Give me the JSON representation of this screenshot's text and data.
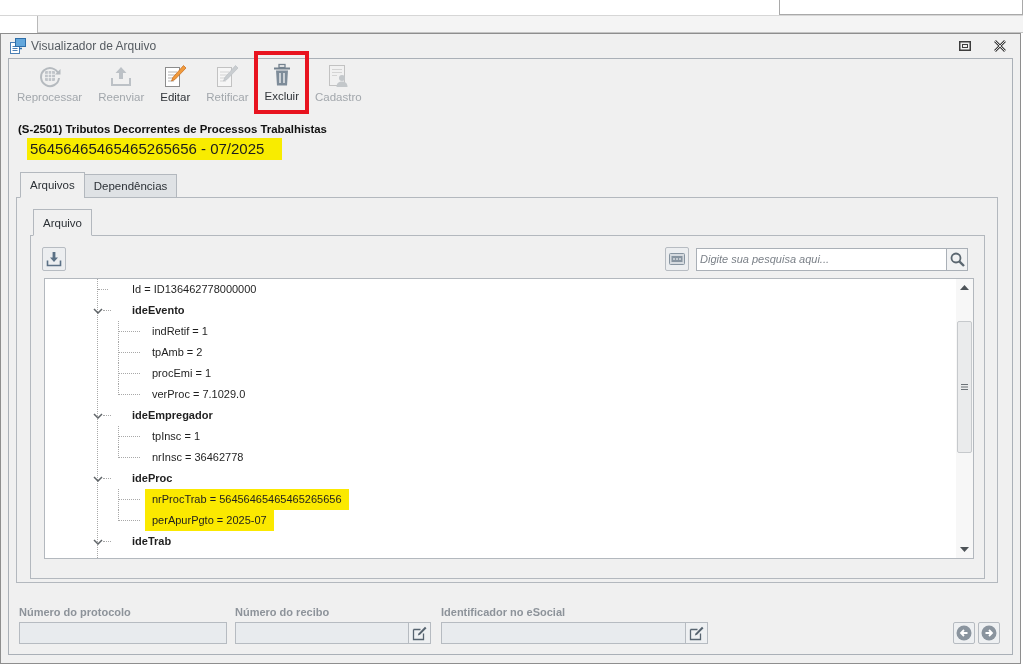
{
  "window": {
    "title": "Visualizador de Arquivo"
  },
  "toolbar": [
    {
      "kind": "reprocess",
      "label": "Reprocessar",
      "disabled": true,
      "marked": false
    },
    {
      "kind": "resend",
      "label": "Reenviar",
      "disabled": true,
      "marked": false
    },
    {
      "kind": "edit",
      "label": "Editar",
      "disabled": false,
      "marked": false
    },
    {
      "kind": "rectify",
      "label": "Retificar",
      "disabled": true,
      "marked": false
    },
    {
      "kind": "delete",
      "label": "Excluir",
      "disabled": false,
      "marked": true
    },
    {
      "kind": "register",
      "label": "Cadastro",
      "disabled": true,
      "marked": false
    }
  ],
  "record": {
    "title": "(S-2501) Tributos Decorrentes de Processos Trabalhistas",
    "subtitle": "56456465465465265656 - 07/2025",
    "highlighted": true
  },
  "tabs": [
    {
      "label": "Arquivos",
      "selected": true
    },
    {
      "label": "Dependências",
      "selected": false
    }
  ],
  "file_tabs": [
    {
      "label": "Arquivo",
      "selected": true
    }
  ],
  "search": {
    "placeholder": "Digite sua pesquisa aqui..."
  },
  "tree": [
    {
      "kind": "leaf",
      "label": "Id = ID136462778000000",
      "highlighted": false
    },
    {
      "kind": "group",
      "label": "ideEvento",
      "expanded": true,
      "highlighted": false,
      "children": [
        {
          "kind": "leaf",
          "label": "indRetif = 1",
          "highlighted": false
        },
        {
          "kind": "leaf",
          "label": "tpAmb = 2",
          "highlighted": false
        },
        {
          "kind": "leaf",
          "label": "procEmi = 1",
          "highlighted": false
        },
        {
          "kind": "leaf",
          "label": "verProc = 7.1029.0",
          "highlighted": false
        }
      ]
    },
    {
      "kind": "group",
      "label": "ideEmpregador",
      "expanded": true,
      "highlighted": false,
      "children": [
        {
          "kind": "leaf",
          "label": "tpInsc = 1",
          "highlighted": false
        },
        {
          "kind": "leaf",
          "label": "nrInsc = 36462778",
          "highlighted": false
        }
      ]
    },
    {
      "kind": "group",
      "label": "ideProc",
      "expanded": true,
      "highlighted": false,
      "children": [
        {
          "kind": "leaf",
          "label": "nrProcTrab = 56456465465465265656",
          "highlighted": true
        },
        {
          "kind": "leaf",
          "label": "perApurPgto = 2025-07",
          "highlighted": true
        }
      ]
    },
    {
      "kind": "group",
      "label": "ideTrab",
      "expanded": true,
      "highlighted": false
    }
  ],
  "fields": [
    {
      "label": "Número do protocolo",
      "kind": "plain",
      "disabled": true
    },
    {
      "label": "Número do recibo",
      "kind": "with_edit",
      "disabled": true
    },
    {
      "label": "Identificador no eSocial",
      "kind": "with_edit",
      "disabled": true
    }
  ]
}
